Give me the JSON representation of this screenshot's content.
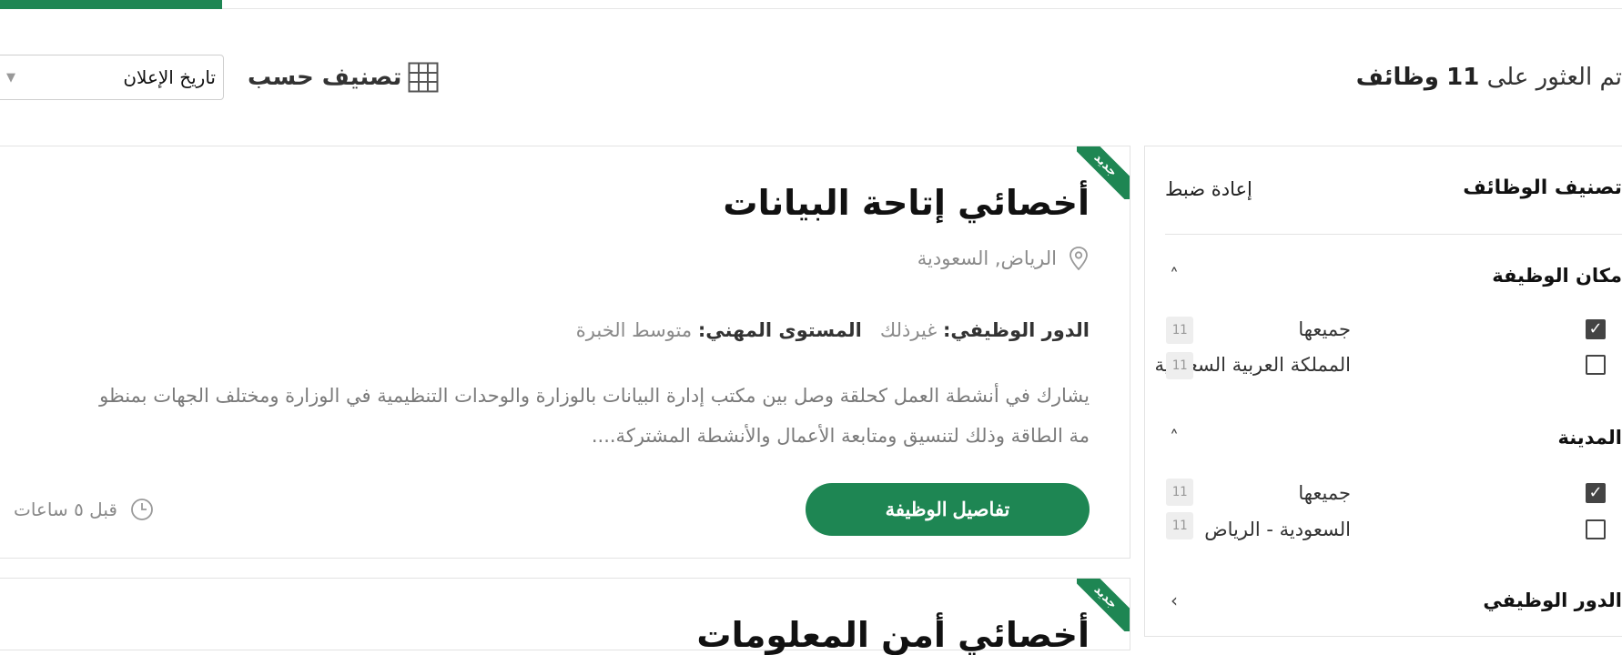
{
  "progress": {
    "fraction": 0.137
  },
  "results": {
    "prefix": "تم العثور على",
    "count": "11",
    "suffix": "وظائف"
  },
  "sort": {
    "label": "تصنيف حسب",
    "selected": "تاريخ الإعلان"
  },
  "jobs": [
    {
      "badge": "جديد",
      "title": "أخصائي إتاحة البيانات",
      "location": "الرياض, السعودية",
      "role_key": "الدور الوظيفي:",
      "role_value": "غيرذلك",
      "level_key": "المستوى المهني:",
      "level_value": "متوسط الخبرة",
      "desc_line1": "يشارك في أنشطة العمل كحلقة وصل بين مكتب إدارة البيانات بالوزارة والوحدات التنظيمية في الوزارة ومختلف الجهات بمنظو",
      "desc_line2": "مة الطاقة وذلك لتنسيق ومتابعة الأعمال والأنشطة المشتركة....",
      "details_button": "تفاصيل الوظيفة",
      "time_ago": "قبل ٥ ساعات"
    },
    {
      "badge": "جديد",
      "title": "أخصائي أمن المعلومات"
    }
  ],
  "filters": {
    "title": "تصنيف الوظائف",
    "reset": "إعادة ضبط",
    "sections": [
      {
        "title": "مكان الوظيفة",
        "options": [
          {
            "label": "جميعها",
            "checked": true,
            "count": "11"
          },
          {
            "label": "المملكة العربية السعودية",
            "checked": false,
            "count": "11"
          }
        ]
      },
      {
        "title": "المدينة",
        "options": [
          {
            "label": "جميعها",
            "checked": true,
            "count": "11"
          },
          {
            "label": "السعودية - الرياض",
            "checked": false,
            "count": "11"
          }
        ]
      },
      {
        "title": "الدور الوظيفي",
        "options": []
      }
    ]
  },
  "colors": {
    "accent": "#1e8653"
  }
}
